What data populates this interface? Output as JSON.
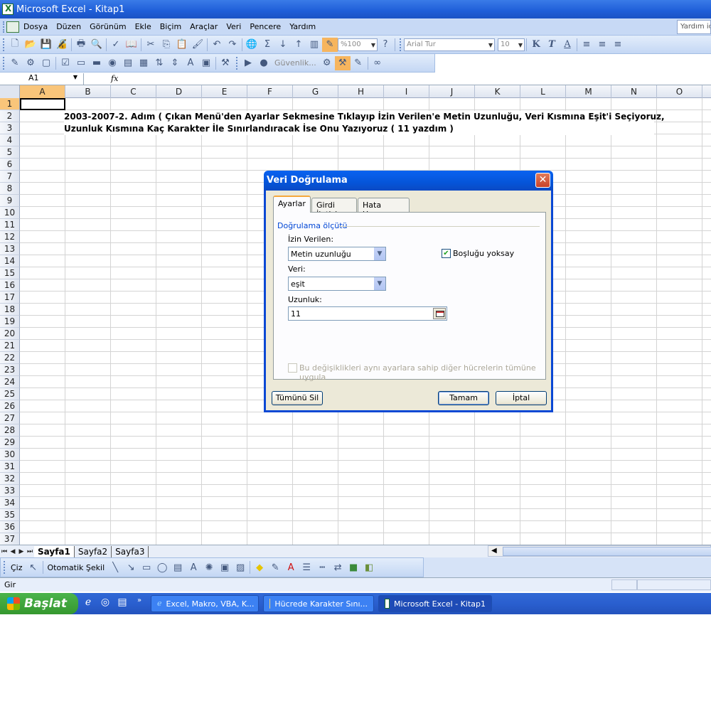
{
  "window": {
    "title": "Microsoft Excel - Kitap1"
  },
  "menu": {
    "items": [
      {
        "label": "Dosya"
      },
      {
        "label": "Düzen"
      },
      {
        "label": "Görünüm"
      },
      {
        "label": "Ekle"
      },
      {
        "label": "Biçim"
      },
      {
        "label": "Araçlar"
      },
      {
        "label": "Veri"
      },
      {
        "label": "Pencere"
      },
      {
        "label": "Yardım"
      }
    ],
    "help_box": "Yardım için"
  },
  "toolbar": {
    "zoom": "%100",
    "font": "Arial Tur",
    "font_size": "10",
    "bold": "K",
    "italic": "T",
    "underline": "A",
    "security": "Güvenlik..."
  },
  "formula_bar": {
    "name_box": "A1",
    "fx": "fx"
  },
  "grid": {
    "columns": [
      "A",
      "B",
      "C",
      "D",
      "E",
      "F",
      "G",
      "H",
      "I",
      "J",
      "K",
      "L",
      "M",
      "N",
      "O"
    ],
    "rows": [
      "1",
      "2",
      "3",
      "4",
      "5",
      "6",
      "7",
      "8",
      "9",
      "10",
      "11",
      "12",
      "13",
      "14",
      "15",
      "16",
      "17",
      "18",
      "19",
      "20",
      "21",
      "22",
      "23",
      "24",
      "25",
      "26",
      "27",
      "28",
      "29",
      "30",
      "31",
      "32",
      "33",
      "34",
      "35",
      "36",
      "37"
    ],
    "active_cell": "A1",
    "cell_b2": "2003-2007-2. Adım ( Çıkan Menü'den Ayarlar Sekmesine Tıklayıp İzin Verilen'e Metin Uzunluğu, Veri Kısmına Eşit'i Seçiyoruz,",
    "cell_b3": "Uzunluk Kısmına Kaç Karakter İle Sınırlandıracak İse Onu Yazıyoruz ( 11 yazdım )"
  },
  "sheets": {
    "tabs": [
      "Sayfa1",
      "Sayfa2",
      "Sayfa3"
    ],
    "active": "Sayfa1"
  },
  "draw_toolbar": {
    "draw": "Çiz",
    "autoshapes": "Otomatik Şekil"
  },
  "status": {
    "mode": "Gir"
  },
  "taskbar": {
    "start": "Başlat",
    "tasks": [
      {
        "label": "Excel, Makro, VBA, K..."
      },
      {
        "label": "Hücrede Karakter Sını..."
      },
      {
        "label": "Microsoft Excel - Kitap1"
      }
    ]
  },
  "dialog": {
    "title": "Veri Doğrulama",
    "tabs": [
      "Ayarlar",
      "Girdi İletisi",
      "Hata Uyarısı"
    ],
    "active_tab": "Ayarlar",
    "group_label": "Doğrulama ölçütü",
    "allow_label": "İzin Verilen:",
    "allow_value": "Metin uzunluğu",
    "ignore_blank_label": "Boşluğu yoksay",
    "ignore_blank_checked": true,
    "data_label": "Veri:",
    "data_value": "eşit",
    "length_label": "Uzunluk:",
    "length_value": "11",
    "apply_all_label": "Bu değişiklikleri aynı ayarlara sahip diğer hücrelerin tümüne uygula",
    "clear_all_button": "Tümünü Sil",
    "ok_button": "Tamam",
    "cancel_button": "İptal"
  }
}
